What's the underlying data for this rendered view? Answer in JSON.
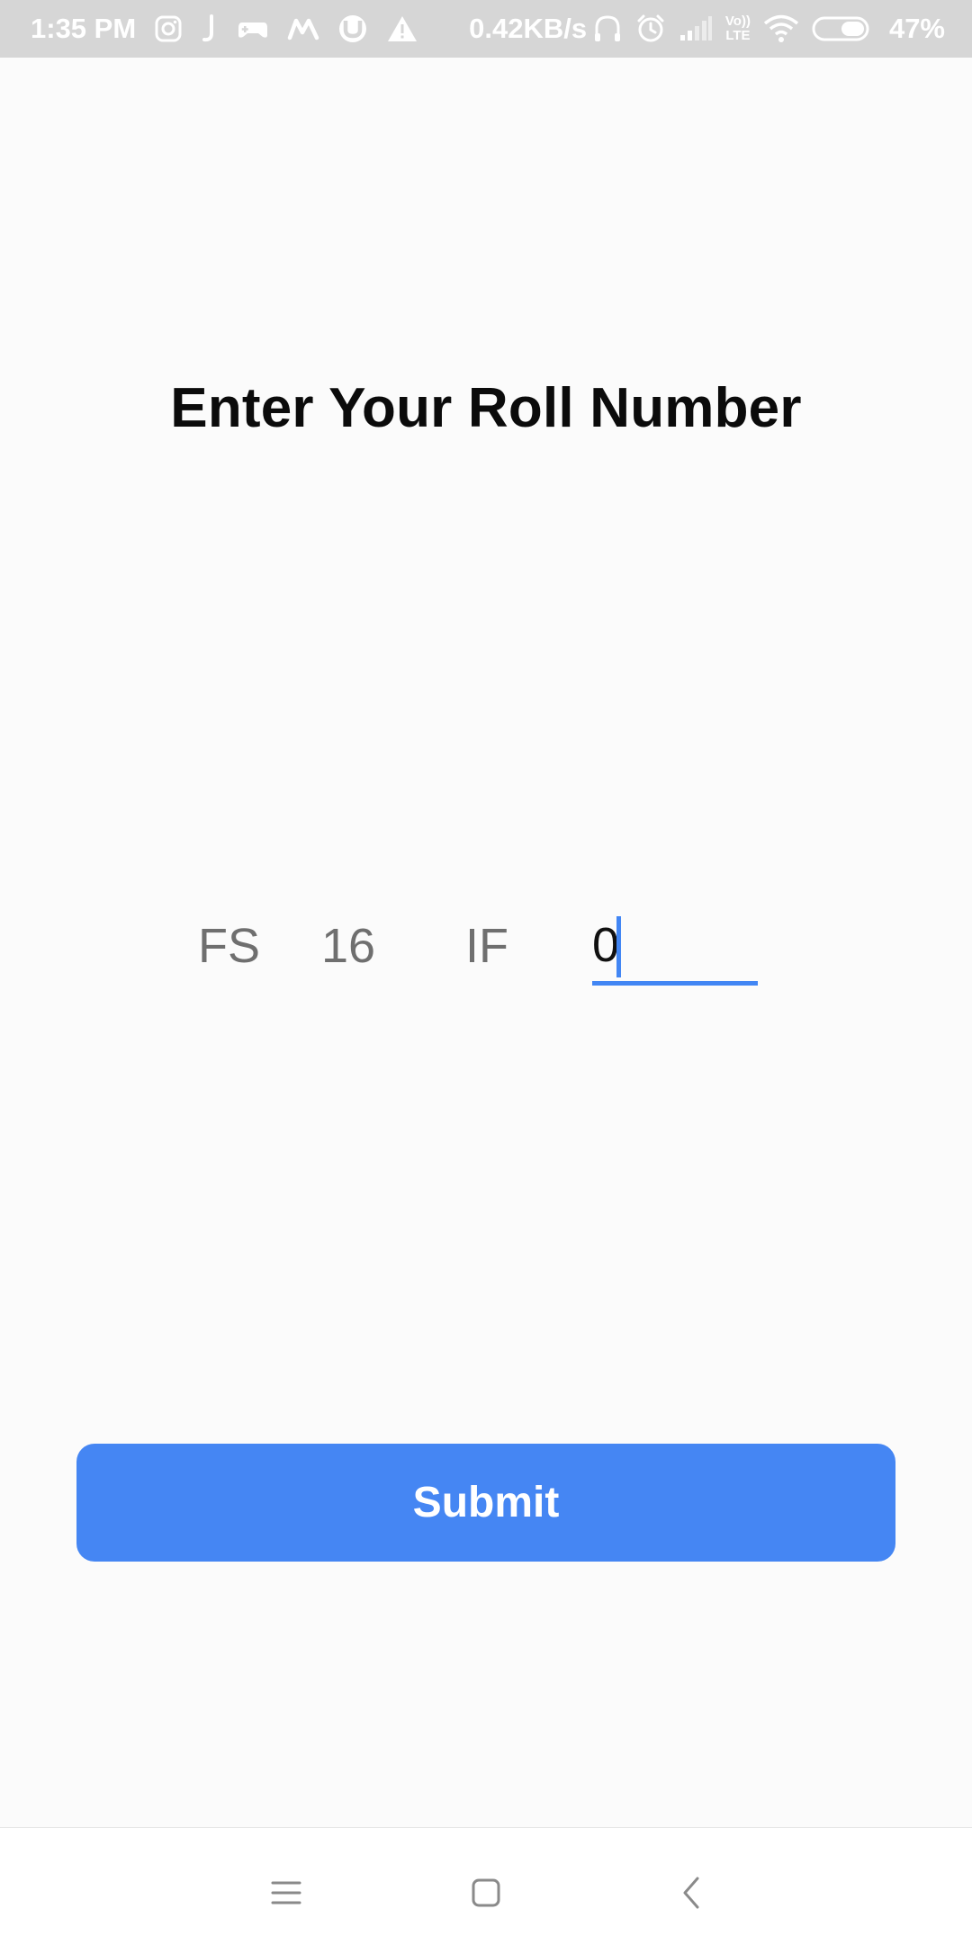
{
  "status_bar": {
    "time": "1:35 PM",
    "net_speed": "0.42KB/s",
    "battery": "47%",
    "icons": [
      "instagram-icon",
      "j-app-icon",
      "game-controller-icon",
      "m-app-icon",
      "utorrent-icon",
      "warning-icon",
      "headphones-icon",
      "alarm-icon",
      "signal-icon",
      "volte-icon",
      "wifi-icon",
      "battery-icon"
    ],
    "volte_label": [
      "Vo))",
      "LTE"
    ]
  },
  "title": "Enter Your Roll Number",
  "roll_number": {
    "segments": [
      "FS",
      "16",
      "IF"
    ],
    "input_value": "0"
  },
  "submit_label": "Submit",
  "colors": {
    "accent": "#4286f4",
    "status_bar_bg": "#d6d6d6",
    "background": "#fbfbfb"
  },
  "nav_bar": {
    "icons": [
      "menu-icon",
      "home-square-icon",
      "back-chevron-icon"
    ]
  }
}
